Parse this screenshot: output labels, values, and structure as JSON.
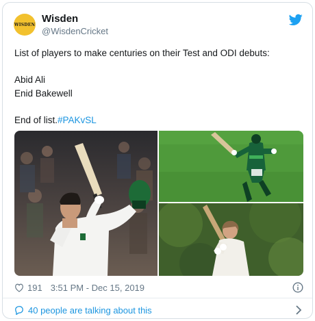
{
  "tweet": {
    "author_name": "Wisden",
    "author_handle": "@WisdenCricket",
    "avatar_text": "WISDEN",
    "lines": [
      "List of players to make centuries on their Test and ODI debuts:",
      "Abid Ali",
      "Enid Bakewell"
    ],
    "closing_text": "End of list.",
    "hashtag": "#PAKvSL"
  },
  "stats": {
    "likes": "191",
    "timestamp": "3:51 PM - Dec 15, 2019"
  },
  "footer": {
    "conversation_label": "40 people are talking about this"
  },
  "colors": {
    "link": "#1b95e0",
    "muted": "#657786",
    "avatar_bg": "#f2c12e"
  },
  "icons": {
    "platform": "twitter-bird-icon",
    "like": "heart-icon",
    "info": "info-icon",
    "conversation": "speech-bubble-icon",
    "more": "chevron-right-icon"
  }
}
